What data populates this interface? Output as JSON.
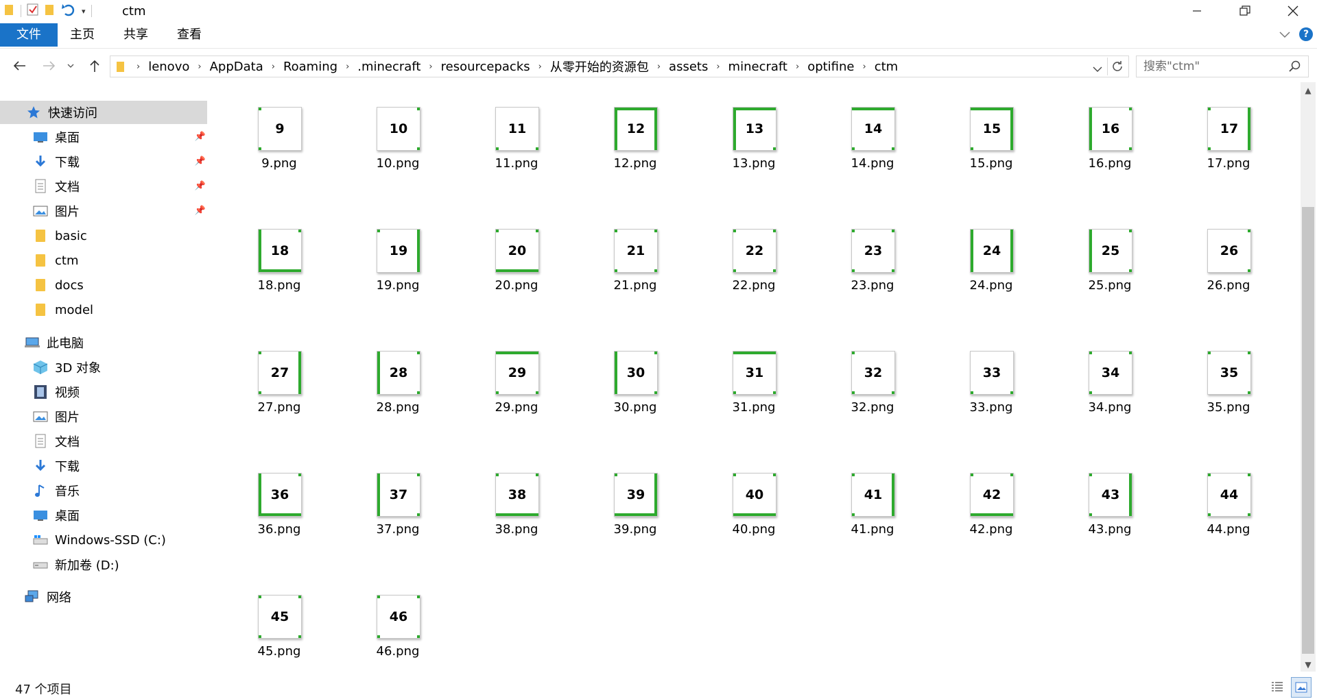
{
  "window": {
    "title": "ctm"
  },
  "ribbon": {
    "tabs": [
      "文件",
      "主页",
      "共享",
      "查看"
    ]
  },
  "address": {
    "crumbs": [
      "lenovo",
      "AppData",
      "Roaming",
      ".minecraft",
      "resourcepacks",
      "从零开始的资源包",
      "assets",
      "minecraft",
      "optifine",
      "ctm"
    ]
  },
  "search": {
    "placeholder": "搜索\"ctm\""
  },
  "sidebar": {
    "quick_access": "快速访问",
    "quick_items": [
      {
        "label": "桌面",
        "icon": "desktop-icon"
      },
      {
        "label": "下载",
        "icon": "download-icon"
      },
      {
        "label": "文档",
        "icon": "document-icon"
      },
      {
        "label": "图片",
        "icon": "picture-icon"
      },
      {
        "label": "basic",
        "icon": "folder-icon"
      },
      {
        "label": "ctm",
        "icon": "folder-icon"
      },
      {
        "label": "docs",
        "icon": "folder-icon"
      },
      {
        "label": "model",
        "icon": "folder-icon"
      }
    ],
    "this_pc": "此电脑",
    "pc_items": [
      {
        "label": "3D 对象",
        "icon": "3d-objects-icon"
      },
      {
        "label": "视频",
        "icon": "video-icon"
      },
      {
        "label": "图片",
        "icon": "picture-icon"
      },
      {
        "label": "文档",
        "icon": "document-icon"
      },
      {
        "label": "下载",
        "icon": "download-icon"
      },
      {
        "label": "音乐",
        "icon": "music-icon"
      },
      {
        "label": "桌面",
        "icon": "desktop-icon"
      },
      {
        "label": "Windows-SSD (C:)",
        "icon": "drive-c-icon"
      },
      {
        "label": "新加卷 (D:)",
        "icon": "drive-d-icon"
      }
    ],
    "network": "网络"
  },
  "files": [
    {
      "num": "9",
      "name": "9.png",
      "edges": "",
      "corners": "tl,bl"
    },
    {
      "num": "10",
      "name": "10.png",
      "edges": "",
      "corners": "tr,br"
    },
    {
      "num": "11",
      "name": "11.png",
      "edges": "",
      "corners": "bl,br"
    },
    {
      "num": "12",
      "name": "12.png",
      "edges": "t,l,r",
      "corners": ""
    },
    {
      "num": "13",
      "name": "13.png",
      "edges": "t,l",
      "corners": "br"
    },
    {
      "num": "14",
      "name": "14.png",
      "edges": "t",
      "corners": "bl,br"
    },
    {
      "num": "15",
      "name": "15.png",
      "edges": "t,r",
      "corners": "bl"
    },
    {
      "num": "16",
      "name": "16.png",
      "edges": "l",
      "corners": "tr,br"
    },
    {
      "num": "17",
      "name": "17.png",
      "edges": "r",
      "corners": "tl,bl"
    },
    {
      "num": "18",
      "name": "18.png",
      "edges": "l,b",
      "corners": "tr"
    },
    {
      "num": "19",
      "name": "19.png",
      "edges": "r",
      "corners": "tl"
    },
    {
      "num": "20",
      "name": "20.png",
      "edges": "b",
      "corners": "tl,tr"
    },
    {
      "num": "21",
      "name": "21.png",
      "edges": "",
      "corners": "tl,tr,bl,br"
    },
    {
      "num": "22",
      "name": "22.png",
      "edges": "",
      "corners": "tl,tr,bl,br"
    },
    {
      "num": "23",
      "name": "23.png",
      "edges": "",
      "corners": "tl,tr,bl,br"
    },
    {
      "num": "24",
      "name": "24.png",
      "edges": "l,r",
      "corners": ""
    },
    {
      "num": "25",
      "name": "25.png",
      "edges": "l",
      "corners": "tr,br"
    },
    {
      "num": "26",
      "name": "26.png",
      "edges": "",
      "corners": "tr,br"
    },
    {
      "num": "27",
      "name": "27.png",
      "edges": "r",
      "corners": "tl,bl"
    },
    {
      "num": "28",
      "name": "28.png",
      "edges": "l",
      "corners": "tr,br"
    },
    {
      "num": "29",
      "name": "29.png",
      "edges": "t",
      "corners": "bl,br"
    },
    {
      "num": "30",
      "name": "30.png",
      "edges": "l",
      "corners": "tr,br"
    },
    {
      "num": "31",
      "name": "31.png",
      "edges": "t",
      "corners": "bl,br"
    },
    {
      "num": "32",
      "name": "32.png",
      "edges": "",
      "corners": "tl,bl,br"
    },
    {
      "num": "33",
      "name": "33.png",
      "edges": "",
      "corners": "bl,br"
    },
    {
      "num": "34",
      "name": "34.png",
      "edges": "",
      "corners": "tl,tr,bl"
    },
    {
      "num": "35",
      "name": "35.png",
      "edges": "",
      "corners": "tl,tr,br"
    },
    {
      "num": "36",
      "name": "36.png",
      "edges": "l,b",
      "corners": "tr"
    },
    {
      "num": "37",
      "name": "37.png",
      "edges": "l",
      "corners": "tr,br"
    },
    {
      "num": "38",
      "name": "38.png",
      "edges": "b",
      "corners": "tl,tr"
    },
    {
      "num": "39",
      "name": "39.png",
      "edges": "r,b",
      "corners": "tl"
    },
    {
      "num": "40",
      "name": "40.png",
      "edges": "b",
      "corners": "tl,tr"
    },
    {
      "num": "41",
      "name": "41.png",
      "edges": "r",
      "corners": "tl,bl"
    },
    {
      "num": "42",
      "name": "42.png",
      "edges": "b",
      "corners": "tl,tr"
    },
    {
      "num": "43",
      "name": "43.png",
      "edges": "r",
      "corners": "tl,bl"
    },
    {
      "num": "44",
      "name": "44.png",
      "edges": "",
      "corners": "tl,tr,bl,br"
    },
    {
      "num": "45",
      "name": "45.png",
      "edges": "",
      "corners": "tl,tr,bl,br"
    },
    {
      "num": "46",
      "name": "46.png",
      "edges": "",
      "corners": "tl,tr,bl,br"
    }
  ],
  "status": {
    "count": "47 个项目"
  },
  "colors": {
    "accent": "#1a73c8",
    "tile_green": "#2eaa2e",
    "selected_bg": "#d9d9d9"
  }
}
